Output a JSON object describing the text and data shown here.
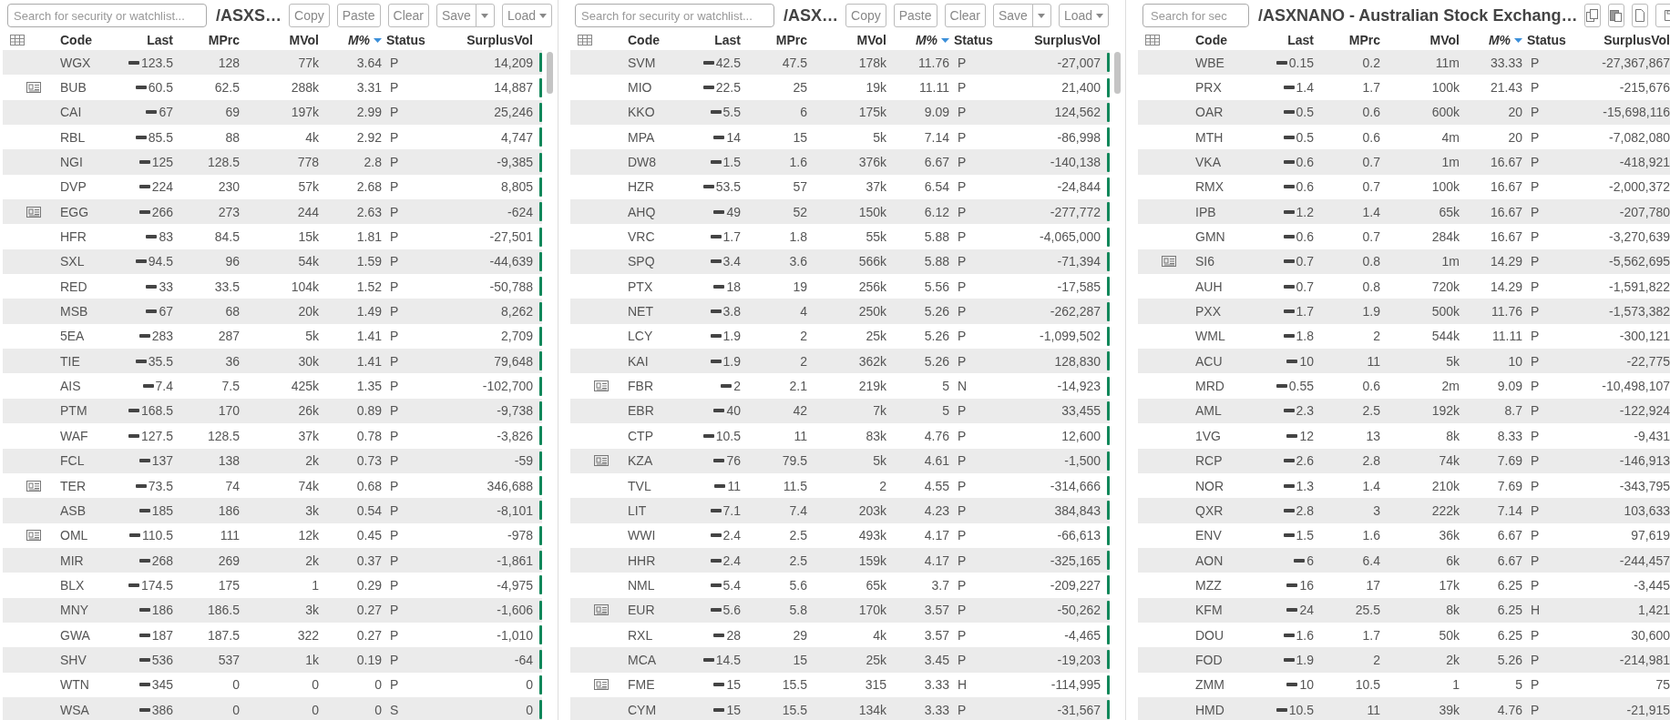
{
  "panels": [
    {
      "search": {
        "placeholder": "Search for security or watchlist..."
      },
      "title": "/ASXS…",
      "toolbar": [
        {
          "kind": "copy",
          "label": "Copy"
        },
        {
          "kind": "paste",
          "label": "Paste"
        },
        {
          "kind": "clear",
          "label": "Clear"
        },
        {
          "kind": "save",
          "label": "Save"
        },
        {
          "kind": "load",
          "label": "Load"
        }
      ],
      "columns": [
        {
          "label": "Code",
          "sorted": false
        },
        {
          "label": "Last",
          "sorted": false
        },
        {
          "label": "MPrc",
          "sorted": false
        },
        {
          "label": "MVol",
          "sorted": false
        },
        {
          "label": "M%",
          "sorted": true
        },
        {
          "label": "Status",
          "sorted": false
        },
        {
          "label": "SurplusVol",
          "sorted": false
        }
      ],
      "rows": [
        {
          "news": false,
          "cells": [
            "WGX",
            "123.5",
            "128",
            "77k",
            "3.64",
            "P",
            "14,209"
          ]
        },
        {
          "news": true,
          "cells": [
            "BUB",
            "60.5",
            "62.5",
            "288k",
            "3.31",
            "P",
            "14,887"
          ]
        },
        {
          "news": false,
          "cells": [
            "CAI",
            "67",
            "69",
            "197k",
            "2.99",
            "P",
            "25,246"
          ]
        },
        {
          "news": false,
          "cells": [
            "RBL",
            "85.5",
            "88",
            "4k",
            "2.92",
            "P",
            "4,747"
          ]
        },
        {
          "news": false,
          "cells": [
            "NGI",
            "125",
            "128.5",
            "778",
            "2.8",
            "P",
            "-9,385"
          ]
        },
        {
          "news": false,
          "cells": [
            "DVP",
            "224",
            "230",
            "57k",
            "2.68",
            "P",
            "8,805"
          ]
        },
        {
          "news": true,
          "cells": [
            "EGG",
            "266",
            "273",
            "244",
            "2.63",
            "P",
            "-624"
          ]
        },
        {
          "news": false,
          "cells": [
            "HFR",
            "83",
            "84.5",
            "15k",
            "1.81",
            "P",
            "-27,501"
          ]
        },
        {
          "news": false,
          "cells": [
            "SXL",
            "94.5",
            "96",
            "54k",
            "1.59",
            "P",
            "-44,639"
          ]
        },
        {
          "news": false,
          "cells": [
            "RED",
            "33",
            "33.5",
            "104k",
            "1.52",
            "P",
            "-50,788"
          ]
        },
        {
          "news": false,
          "cells": [
            "MSB",
            "67",
            "68",
            "20k",
            "1.49",
            "P",
            "8,262"
          ]
        },
        {
          "news": false,
          "cells": [
            "5EA",
            "283",
            "287",
            "5k",
            "1.41",
            "P",
            "2,709"
          ]
        },
        {
          "news": false,
          "cells": [
            "TIE",
            "35.5",
            "36",
            "30k",
            "1.41",
            "P",
            "79,648"
          ]
        },
        {
          "news": false,
          "cells": [
            "AIS",
            "7.4",
            "7.5",
            "425k",
            "1.35",
            "P",
            "-102,700"
          ]
        },
        {
          "news": false,
          "cells": [
            "PTM",
            "168.5",
            "170",
            "26k",
            "0.89",
            "P",
            "-9,738"
          ]
        },
        {
          "news": false,
          "cells": [
            "WAF",
            "127.5",
            "128.5",
            "37k",
            "0.78",
            "P",
            "-3,826"
          ]
        },
        {
          "news": false,
          "cells": [
            "FCL",
            "137",
            "138",
            "2k",
            "0.73",
            "P",
            "-59"
          ]
        },
        {
          "news": true,
          "cells": [
            "TER",
            "73.5",
            "74",
            "74k",
            "0.68",
            "P",
            "346,688"
          ]
        },
        {
          "news": false,
          "cells": [
            "ASB",
            "185",
            "186",
            "3k",
            "0.54",
            "P",
            "-8,101"
          ]
        },
        {
          "news": true,
          "cells": [
            "OML",
            "110.5",
            "111",
            "12k",
            "0.45",
            "P",
            "-978"
          ]
        },
        {
          "news": false,
          "cells": [
            "MIR",
            "268",
            "269",
            "2k",
            "0.37",
            "P",
            "-1,861"
          ]
        },
        {
          "news": false,
          "cells": [
            "BLX",
            "174.5",
            "175",
            "1",
            "0.29",
            "P",
            "-4,975"
          ]
        },
        {
          "news": false,
          "cells": [
            "MNY",
            "186",
            "186.5",
            "3k",
            "0.27",
            "P",
            "-1,606"
          ]
        },
        {
          "news": false,
          "cells": [
            "GWA",
            "187",
            "187.5",
            "322",
            "0.27",
            "P",
            "-1,010"
          ]
        },
        {
          "news": false,
          "cells": [
            "SHV",
            "536",
            "537",
            "1k",
            "0.19",
            "P",
            "-64"
          ]
        },
        {
          "news": false,
          "cells": [
            "WTN",
            "345",
            "0",
            "0",
            "0",
            "P",
            "0"
          ]
        },
        {
          "news": false,
          "cells": [
            "WSA",
            "386",
            "0",
            "0",
            "0",
            "S",
            "0"
          ]
        }
      ]
    },
    {
      "search": {
        "placeholder": "Search for security or watchlist..."
      },
      "title": "/ASX…",
      "toolbar": [
        {
          "kind": "copy",
          "label": "Copy"
        },
        {
          "kind": "paste",
          "label": "Paste"
        },
        {
          "kind": "clear",
          "label": "Clear"
        },
        {
          "kind": "save",
          "label": "Save"
        },
        {
          "kind": "load",
          "label": "Load"
        }
      ],
      "columns": [
        {
          "label": "Code",
          "sorted": false
        },
        {
          "label": "Last",
          "sorted": false
        },
        {
          "label": "MPrc",
          "sorted": false
        },
        {
          "label": "MVol",
          "sorted": false
        },
        {
          "label": "M%",
          "sorted": true
        },
        {
          "label": "Status",
          "sorted": false
        },
        {
          "label": "SurplusVol",
          "sorted": false
        }
      ],
      "rows": [
        {
          "news": false,
          "cells": [
            "SVM",
            "42.5",
            "47.5",
            "178k",
            "11.76",
            "P",
            "-27,007"
          ]
        },
        {
          "news": false,
          "cells": [
            "MIO",
            "22.5",
            "25",
            "19k",
            "11.11",
            "P",
            "21,400"
          ]
        },
        {
          "news": false,
          "cells": [
            "KKO",
            "5.5",
            "6",
            "175k",
            "9.09",
            "P",
            "124,562"
          ]
        },
        {
          "news": false,
          "cells": [
            "MPA",
            "14",
            "15",
            "5k",
            "7.14",
            "P",
            "-86,998"
          ]
        },
        {
          "news": false,
          "cells": [
            "DW8",
            "1.5",
            "1.6",
            "376k",
            "6.67",
            "P",
            "-140,138"
          ]
        },
        {
          "news": false,
          "cells": [
            "HZR",
            "53.5",
            "57",
            "37k",
            "6.54",
            "P",
            "-24,844"
          ]
        },
        {
          "news": false,
          "cells": [
            "AHQ",
            "49",
            "52",
            "150k",
            "6.12",
            "P",
            "-277,772"
          ]
        },
        {
          "news": false,
          "cells": [
            "VRC",
            "1.7",
            "1.8",
            "55k",
            "5.88",
            "P",
            "-4,065,000"
          ]
        },
        {
          "news": false,
          "cells": [
            "SPQ",
            "3.4",
            "3.6",
            "566k",
            "5.88",
            "P",
            "-71,394"
          ]
        },
        {
          "news": false,
          "cells": [
            "PTX",
            "18",
            "19",
            "256k",
            "5.56",
            "P",
            "-17,585"
          ]
        },
        {
          "news": false,
          "cells": [
            "NET",
            "3.8",
            "4",
            "250k",
            "5.26",
            "P",
            "-262,287"
          ]
        },
        {
          "news": false,
          "cells": [
            "LCY",
            "1.9",
            "2",
            "25k",
            "5.26",
            "P",
            "-1,099,502"
          ]
        },
        {
          "news": false,
          "cells": [
            "KAI",
            "1.9",
            "2",
            "362k",
            "5.26",
            "P",
            "128,830"
          ]
        },
        {
          "news": true,
          "cells": [
            "FBR",
            "2",
            "2.1",
            "219k",
            "5",
            "N",
            "-14,923"
          ]
        },
        {
          "news": false,
          "cells": [
            "EBR",
            "40",
            "42",
            "7k",
            "5",
            "P",
            "33,455"
          ]
        },
        {
          "news": false,
          "cells": [
            "CTP",
            "10.5",
            "11",
            "83k",
            "4.76",
            "P",
            "12,600"
          ]
        },
        {
          "news": true,
          "cells": [
            "KZA",
            "76",
            "79.5",
            "5k",
            "4.61",
            "P",
            "-1,500"
          ]
        },
        {
          "news": false,
          "cells": [
            "TVL",
            "11",
            "11.5",
            "2",
            "4.55",
            "P",
            "-314,666"
          ]
        },
        {
          "news": false,
          "cells": [
            "LIT",
            "7.1",
            "7.4",
            "203k",
            "4.23",
            "P",
            "384,843"
          ]
        },
        {
          "news": false,
          "cells": [
            "WWI",
            "2.4",
            "2.5",
            "493k",
            "4.17",
            "P",
            "-66,613"
          ]
        },
        {
          "news": false,
          "cells": [
            "HHR",
            "2.4",
            "2.5",
            "159k",
            "4.17",
            "P",
            "-325,165"
          ]
        },
        {
          "news": false,
          "cells": [
            "NML",
            "5.4",
            "5.6",
            "65k",
            "3.7",
            "P",
            "-209,227"
          ]
        },
        {
          "news": true,
          "cells": [
            "EUR",
            "5.6",
            "5.8",
            "170k",
            "3.57",
            "P",
            "-50,262"
          ]
        },
        {
          "news": false,
          "cells": [
            "RXL",
            "28",
            "29",
            "4k",
            "3.57",
            "P",
            "-4,465"
          ]
        },
        {
          "news": false,
          "cells": [
            "MCA",
            "14.5",
            "15",
            "25k",
            "3.45",
            "P",
            "-19,203"
          ]
        },
        {
          "news": true,
          "cells": [
            "FME",
            "15",
            "15.5",
            "315",
            "3.33",
            "H",
            "-114,995"
          ]
        },
        {
          "news": false,
          "cells": [
            "CYM",
            "15",
            "15.5",
            "134k",
            "3.33",
            "P",
            "-31,567"
          ]
        }
      ]
    },
    {
      "search": {
        "placeholder": "Search for sec"
      },
      "title": "/ASXNANO - Australian Stock Exchang…",
      "toolbar": [
        {
          "kind": "copy"
        },
        {
          "kind": "paste"
        },
        {
          "kind": "clear"
        },
        {
          "kind": "save"
        }
      ],
      "columns": [
        {
          "label": "Code",
          "sorted": false
        },
        {
          "label": "Last",
          "sorted": false
        },
        {
          "label": "MPrc",
          "sorted": false
        },
        {
          "label": "MVol",
          "sorted": false
        },
        {
          "label": "M%",
          "sorted": true
        },
        {
          "label": "Status",
          "sorted": false
        },
        {
          "label": "SurplusVol",
          "sorted": false
        }
      ],
      "rows": [
        {
          "news": false,
          "cells": [
            "WBE",
            "0.15",
            "0.2",
            "11m",
            "33.33",
            "P",
            "-27,367,867"
          ]
        },
        {
          "news": false,
          "cells": [
            "PRX",
            "1.4",
            "1.7",
            "100k",
            "21.43",
            "P",
            "-215,676"
          ]
        },
        {
          "news": false,
          "cells": [
            "OAR",
            "0.5",
            "0.6",
            "600k",
            "20",
            "P",
            "-15,698,116"
          ]
        },
        {
          "news": false,
          "cells": [
            "MTH",
            "0.5",
            "0.6",
            "4m",
            "20",
            "P",
            "-7,082,080"
          ]
        },
        {
          "news": false,
          "cells": [
            "VKA",
            "0.6",
            "0.7",
            "1m",
            "16.67",
            "P",
            "-418,921"
          ]
        },
        {
          "news": false,
          "cells": [
            "RMX",
            "0.6",
            "0.7",
            "100k",
            "16.67",
            "P",
            "-2,000,372"
          ]
        },
        {
          "news": false,
          "cells": [
            "IPB",
            "1.2",
            "1.4",
            "65k",
            "16.67",
            "P",
            "-207,780"
          ]
        },
        {
          "news": false,
          "cells": [
            "GMN",
            "0.6",
            "0.7",
            "284k",
            "16.67",
            "P",
            "-3,270,639"
          ]
        },
        {
          "news": true,
          "cells": [
            "SI6",
            "0.7",
            "0.8",
            "1m",
            "14.29",
            "P",
            "-5,562,695"
          ]
        },
        {
          "news": false,
          "cells": [
            "AUH",
            "0.7",
            "0.8",
            "720k",
            "14.29",
            "P",
            "-1,591,822"
          ]
        },
        {
          "news": false,
          "cells": [
            "PXX",
            "1.7",
            "1.9",
            "500k",
            "11.76",
            "P",
            "-1,573,382"
          ]
        },
        {
          "news": false,
          "cells": [
            "WML",
            "1.8",
            "2",
            "544k",
            "11.11",
            "P",
            "-300,121"
          ]
        },
        {
          "news": false,
          "cells": [
            "ACU",
            "10",
            "11",
            "5k",
            "10",
            "P",
            "-22,775"
          ]
        },
        {
          "news": false,
          "cells": [
            "MRD",
            "0.55",
            "0.6",
            "2m",
            "9.09",
            "P",
            "-10,498,107"
          ]
        },
        {
          "news": false,
          "cells": [
            "AML",
            "2.3",
            "2.5",
            "192k",
            "8.7",
            "P",
            "-122,924"
          ]
        },
        {
          "news": false,
          "cells": [
            "1VG",
            "12",
            "13",
            "8k",
            "8.33",
            "P",
            "-9,431"
          ]
        },
        {
          "news": false,
          "cells": [
            "RCP",
            "2.6",
            "2.8",
            "74k",
            "7.69",
            "P",
            "-146,913"
          ]
        },
        {
          "news": false,
          "cells": [
            "NOR",
            "1.3",
            "1.4",
            "210k",
            "7.69",
            "P",
            "-343,795"
          ]
        },
        {
          "news": false,
          "cells": [
            "QXR",
            "2.8",
            "3",
            "222k",
            "7.14",
            "P",
            "103,633"
          ]
        },
        {
          "news": false,
          "cells": [
            "ENV",
            "1.5",
            "1.6",
            "36k",
            "6.67",
            "P",
            "97,619"
          ]
        },
        {
          "news": false,
          "cells": [
            "AON",
            "6",
            "6.4",
            "6k",
            "6.67",
            "P",
            "-244,457"
          ]
        },
        {
          "news": false,
          "cells": [
            "MZZ",
            "16",
            "17",
            "17k",
            "6.25",
            "P",
            "-3,445"
          ]
        },
        {
          "news": false,
          "cells": [
            "KFM",
            "24",
            "25.5",
            "8k",
            "6.25",
            "H",
            "1,421"
          ]
        },
        {
          "news": false,
          "cells": [
            "DOU",
            "1.6",
            "1.7",
            "50k",
            "6.25",
            "P",
            "30,600"
          ]
        },
        {
          "news": false,
          "cells": [
            "FOD",
            "1.9",
            "2",
            "2k",
            "5.26",
            "P",
            "-214,981"
          ]
        },
        {
          "news": false,
          "cells": [
            "ZMM",
            "10",
            "10.5",
            "1",
            "5",
            "P",
            "75"
          ]
        },
        {
          "news": false,
          "cells": [
            "HMD",
            "10.5",
            "11",
            "39k",
            "4.76",
            "P",
            "-21,915"
          ]
        }
      ]
    }
  ]
}
